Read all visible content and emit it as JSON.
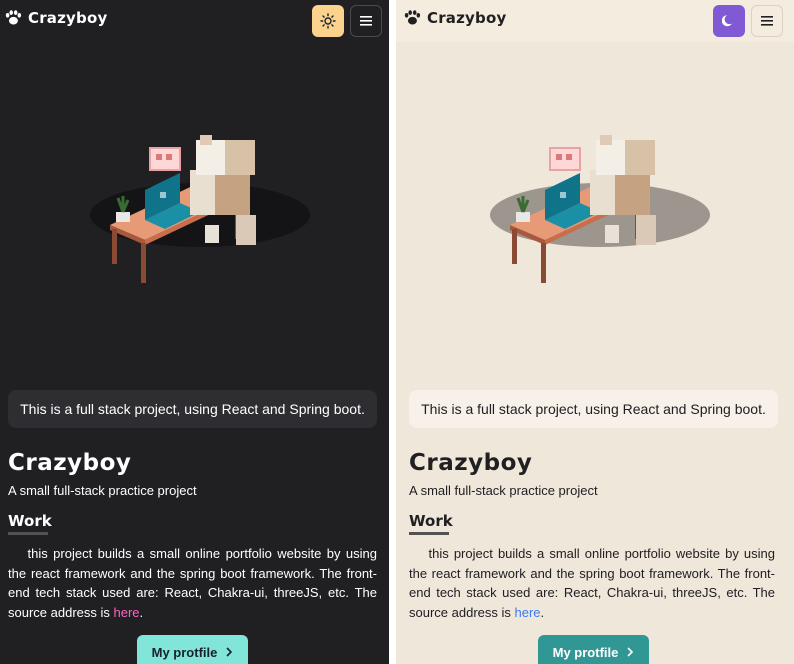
{
  "brand": {
    "name": "Crazyboy",
    "icon": "paw-icon"
  },
  "theme_toggle": {
    "dark_mode_icon": "sun-icon",
    "light_mode_icon": "moon-icon"
  },
  "menu": {
    "icon": "hamburger-menu-icon"
  },
  "hero": {
    "illustration": "voxel-character-at-desk"
  },
  "banner": {
    "text": "This is a full stack project, using React and Spring boot."
  },
  "profile": {
    "title": "Crazyboy",
    "subtitle": "A small full-stack practice project"
  },
  "work": {
    "heading": "Work",
    "text_before_link": "this project builds a small online portfolio website by using the react framework and the spring boot framework. The front-end tech stack used are: React, Chakra-ui, threeJS, etc. The source address is ",
    "link_text": "here",
    "text_after_link": "."
  },
  "cta": {
    "label": "My protfile",
    "icon": "chevron-right-icon"
  },
  "colors": {
    "dark_bg": "#202023",
    "light_bg": "#f0e7db",
    "dark_link": "#ff63c3",
    "light_link": "#3d7aed",
    "dark_button": "#81e6d9",
    "light_button": "#319795",
    "sun_button": "#fbd38d",
    "moon_button": "#805ad5"
  }
}
